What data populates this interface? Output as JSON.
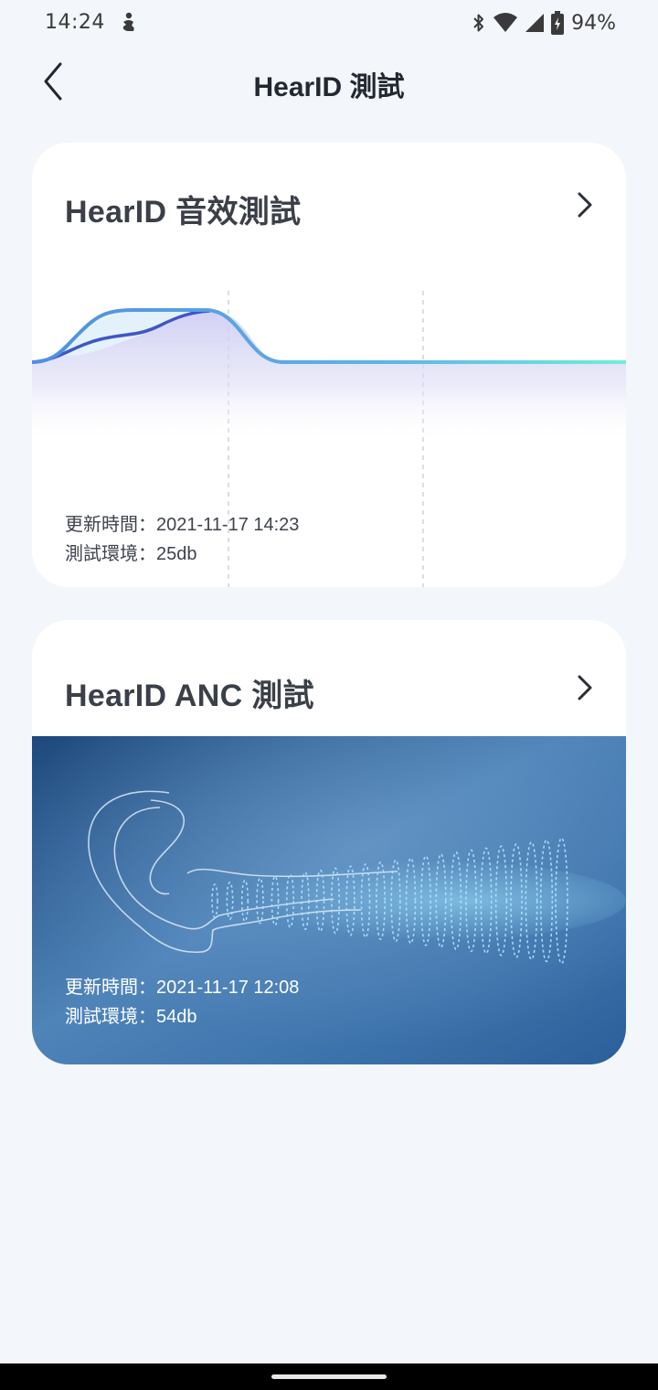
{
  "status_bar": {
    "time": "14:24",
    "battery_percent": "94%",
    "icons": [
      "person-notification-icon",
      "bluetooth-icon",
      "wifi-icon",
      "cellular-signal-icon",
      "battery-charging-icon"
    ]
  },
  "header": {
    "title": "HearID 測試",
    "back_icon": "chevron-left-icon"
  },
  "cards": {
    "eq": {
      "title": "HearID 音效測試",
      "updated_label": "更新時間：",
      "updated_value": "2021-11-17 14:23",
      "environment_label": "測試環境：",
      "environment_value": "25db",
      "chevron_icon": "chevron-right-icon"
    },
    "anc": {
      "title": "HearID ANC 測試",
      "updated_label": "更新時間：",
      "updated_value": "2021-11-17 12:08",
      "environment_label": "測試環境：",
      "environment_value": "54db",
      "chevron_icon": "chevron-right-icon",
      "image": "ear-sound-wave-illustration"
    }
  },
  "colors": {
    "background": "#f3f6fa",
    "card": "#ffffff",
    "curve_primary": "#5b9de8",
    "curve_secondary": "#3f56c8",
    "curve_end": "#6ee8d8",
    "anc_bg_dark": "#1f4a7e",
    "anc_bg_light": "#4d82b8"
  }
}
